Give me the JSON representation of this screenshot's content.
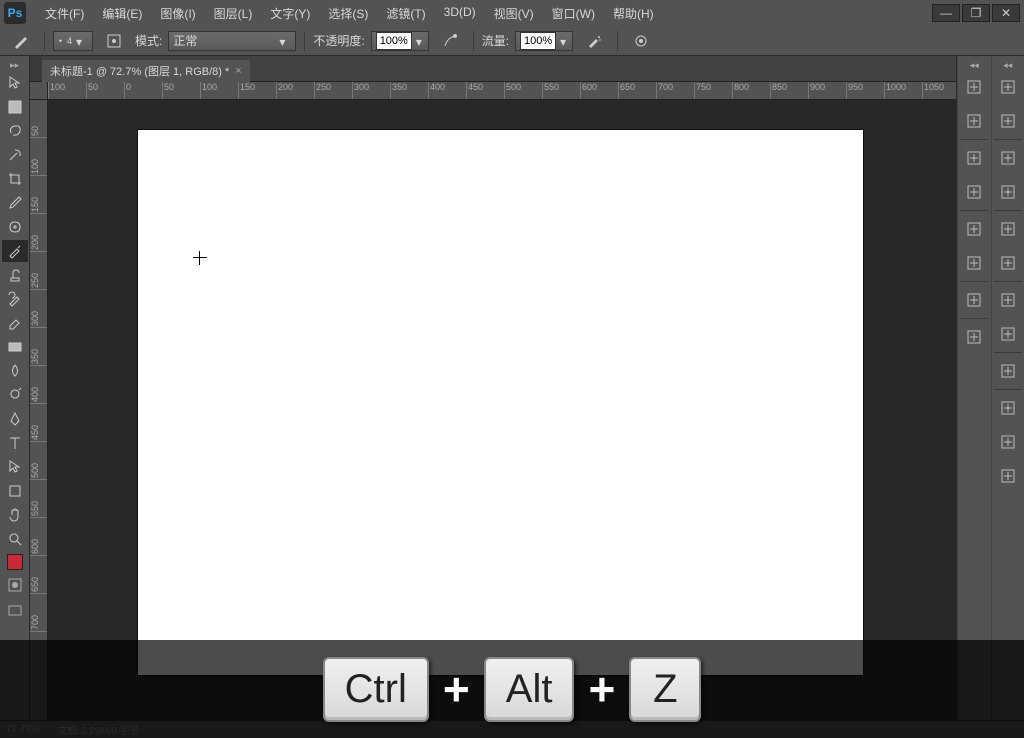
{
  "app": {
    "logo_text": "Ps"
  },
  "menu": [
    "文件(F)",
    "编辑(E)",
    "图像(I)",
    "图层(L)",
    "文字(Y)",
    "选择(S)",
    "滤镜(T)",
    "3D(D)",
    "视图(V)",
    "窗口(W)",
    "帮助(H)"
  ],
  "win_controls": [
    "—",
    "❐",
    "✕"
  ],
  "options": {
    "brush_size": "4",
    "mode_label": "模式:",
    "mode_value": "正常",
    "opacity_label": "不透明度:",
    "opacity_value": "100%",
    "flow_label": "流量:",
    "flow_value": "100%"
  },
  "document": {
    "tab_title": "未标题-1 @ 72.7% (图层 1, RGB/8) *",
    "tab_close": "×"
  },
  "ruler": {
    "h_ticks": [
      "100",
      "50",
      "0",
      "50",
      "100",
      "150",
      "200",
      "250",
      "300",
      "350",
      "400",
      "450",
      "500",
      "550",
      "600",
      "650",
      "700",
      "750",
      "800",
      "850",
      "900",
      "950",
      "1000",
      "1050"
    ],
    "v_ticks": [
      "50",
      "100",
      "150",
      "200",
      "250",
      "300",
      "350",
      "400",
      "450",
      "500",
      "550",
      "600",
      "650",
      "700"
    ]
  },
  "status": {
    "zoom": "72.73%",
    "doc_info": "文档:2.29M/0 字节"
  },
  "shortcut": {
    "key1": "Ctrl",
    "plus": "+",
    "key2": "Alt",
    "key3": "Z"
  },
  "tools": [
    {
      "name": "move-tool"
    },
    {
      "name": "marquee-tool"
    },
    {
      "name": "lasso-tool"
    },
    {
      "name": "quick-select-tool"
    },
    {
      "name": "crop-tool"
    },
    {
      "name": "eyedropper-tool"
    },
    {
      "name": "spot-heal-tool"
    },
    {
      "name": "brush-tool",
      "active": true
    },
    {
      "name": "clone-stamp-tool"
    },
    {
      "name": "history-brush-tool"
    },
    {
      "name": "eraser-tool"
    },
    {
      "name": "gradient-tool"
    },
    {
      "name": "blur-tool"
    },
    {
      "name": "dodge-tool"
    },
    {
      "name": "pen-tool"
    },
    {
      "name": "type-tool"
    },
    {
      "name": "path-select-tool"
    },
    {
      "name": "shape-tool"
    },
    {
      "name": "hand-tool"
    },
    {
      "name": "zoom-tool"
    }
  ],
  "right_col1": [
    {
      "name": "history-icon"
    },
    {
      "name": "actions-icon"
    },
    {
      "sep": true
    },
    {
      "name": "properties-icon"
    },
    {
      "name": "brush-presets-icon"
    },
    {
      "sep": true
    },
    {
      "name": "character-icon"
    },
    {
      "name": "paragraph-icon"
    },
    {
      "sep": true
    },
    {
      "name": "navigator-icon"
    },
    {
      "sep": true
    },
    {
      "name": "layers-panel-icon"
    }
  ],
  "right_col2": [
    {
      "name": "3d-panel-icon"
    },
    {
      "name": "histogram-icon"
    },
    {
      "sep": true
    },
    {
      "name": "info-icon"
    },
    {
      "name": "3d-materials-icon"
    },
    {
      "sep": true
    },
    {
      "name": "color-icon"
    },
    {
      "name": "swatches-icon"
    },
    {
      "sep": true
    },
    {
      "name": "styles-icon"
    },
    {
      "name": "kuler-icon"
    },
    {
      "sep": true
    },
    {
      "name": "adjustments-icon"
    },
    {
      "sep": true
    },
    {
      "name": "layers-icon"
    },
    {
      "name": "channels-icon"
    },
    {
      "name": "paths-icon"
    }
  ]
}
